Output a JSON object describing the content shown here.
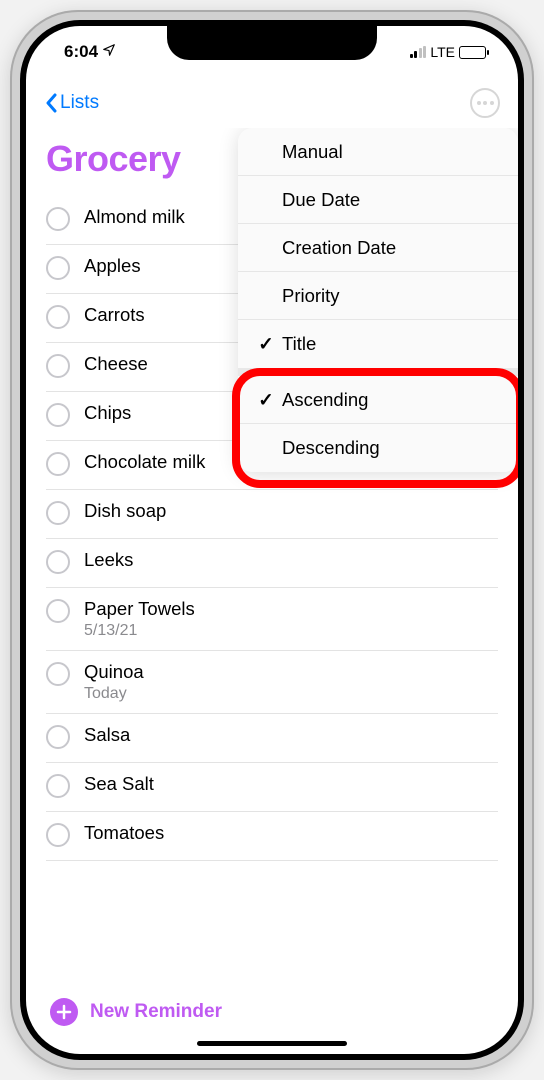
{
  "status": {
    "time": "6:04",
    "carrier": "LTE"
  },
  "nav": {
    "back_label": "Lists"
  },
  "list": {
    "title": "Grocery",
    "new_reminder_label": "New Reminder",
    "items": [
      {
        "label": "Almond milk",
        "sub": ""
      },
      {
        "label": "Apples",
        "sub": ""
      },
      {
        "label": "Carrots",
        "sub": ""
      },
      {
        "label": "Cheese",
        "sub": ""
      },
      {
        "label": "Chips",
        "sub": ""
      },
      {
        "label": "Chocolate milk",
        "sub": ""
      },
      {
        "label": "Dish soap",
        "sub": ""
      },
      {
        "label": "Leeks",
        "sub": ""
      },
      {
        "label": "Paper Towels",
        "sub": "5/13/21"
      },
      {
        "label": "Quinoa",
        "sub": "Today"
      },
      {
        "label": "Salsa",
        "sub": ""
      },
      {
        "label": "Sea Salt",
        "sub": ""
      },
      {
        "label": "Tomatoes",
        "sub": ""
      }
    ]
  },
  "sort_menu": {
    "sort_by": [
      {
        "label": "Manual",
        "checked": false
      },
      {
        "label": "Due Date",
        "checked": false
      },
      {
        "label": "Creation Date",
        "checked": false
      },
      {
        "label": "Priority",
        "checked": false
      },
      {
        "label": "Title",
        "checked": true
      }
    ],
    "order": [
      {
        "label": "Ascending",
        "checked": true
      },
      {
        "label": "Descending",
        "checked": false
      }
    ]
  },
  "annotation": {
    "highlight": "sort-order-options"
  }
}
